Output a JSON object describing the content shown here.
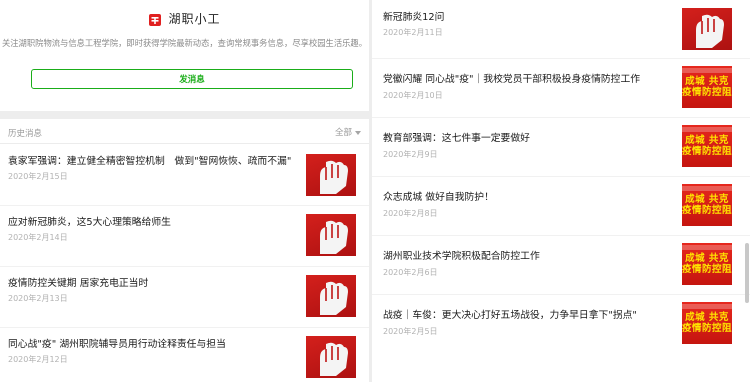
{
  "profile": {
    "name": "湖职小工",
    "description": "关注湖职院物流与信息工程学院，即时获得学院最新动态，查询常规事务信息，尽享校园生活乐趣。",
    "send_button": "发消息",
    "logo_icon": "red-seal-logo-icon"
  },
  "history": {
    "label": "历史消息",
    "filter": "全部",
    "items": [
      {
        "title": "袁家军强调：建立健全精密智控机制　做到\"智网恢恢、疏而不漏\"",
        "date": "2020年2月15日",
        "thumb_icon": "raised-fist-icon"
      },
      {
        "title": "应对新冠肺炎，这5大心理策略给师生",
        "date": "2020年2月14日",
        "thumb_icon": "raised-fist-icon"
      },
      {
        "title": "疫情防控关键期 居家充电正当时",
        "date": "2020年2月13日",
        "thumb_icon": "raised-fist-icon"
      },
      {
        "title": "同心战\"疫\" 湖州职院辅导员用行动诠释责任与担当",
        "date": "2020年2月12日",
        "thumb_icon": "raised-fist-icon"
      }
    ]
  },
  "right_list": {
    "items": [
      {
        "title": "新冠肺炎12问",
        "date": "2020年2月11日",
        "thumb_icon": "raised-fist-icon"
      },
      {
        "title": "党徽闪耀 同心战\"疫\"｜我校党员干部积极投身疫情防控工作",
        "date": "2020年2月10日",
        "thumb_icon": "poster-icon",
        "poster": [
          "成城 共克",
          "疫情防控阻"
        ]
      },
      {
        "title": "教育部强调：这七件事一定要做好",
        "date": "2020年2月9日",
        "thumb_icon": "poster-icon",
        "poster": [
          "成城 共克",
          "疫情防控阻"
        ]
      },
      {
        "title": "众志成城 做好自我防护！",
        "date": "2020年2月8日",
        "thumb_icon": "poster-icon",
        "poster": [
          "成城 共克",
          "疫情防控阻"
        ]
      },
      {
        "title": "湖州职业技术学院积极配合防控工作",
        "date": "2020年2月6日",
        "thumb_icon": "poster-icon",
        "poster": [
          "成城 共克",
          "疫情防控阻"
        ]
      },
      {
        "title": "战疫｜车俊：更大决心打好五场战役，力争早日拿下\"拐点\"",
        "date": "2020年2月5日",
        "thumb_icon": "poster-icon",
        "poster": [
          "成城 共克",
          "疫情防控阻"
        ]
      }
    ]
  },
  "colors": {
    "accent_green": "#1aad19",
    "thumb_red": "#d4201c",
    "poster_yellow": "#ffe400"
  }
}
